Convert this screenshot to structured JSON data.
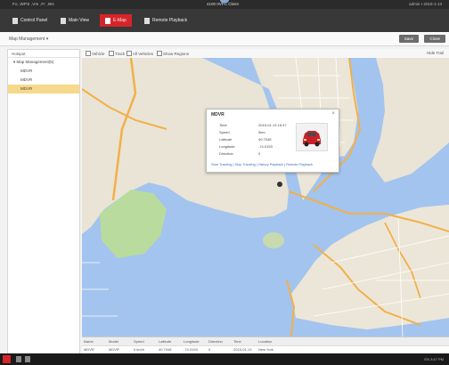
{
  "titlebar": {
    "menu": "Fo  ,WPS  ,Vm  ,Fr  ,Ws",
    "title": "4100 0VPC Client",
    "right": "admin   ▪  2015-1-13"
  },
  "toolbar": {
    "items": [
      {
        "label": "Control Panel",
        "icon": "control-panel-icon"
      },
      {
        "label": "Main View",
        "icon": "main-view-icon"
      },
      {
        "label": "E-Map",
        "icon": "map-icon",
        "active": true
      },
      {
        "label": "Remote Playback",
        "icon": "chart-icon"
      }
    ]
  },
  "subbar": {
    "breadcrumb": "Map Management ▾",
    "buttons": [
      "Save",
      "Close"
    ]
  },
  "leftpanel": {
    "header": "Hotspot",
    "items": [
      "▾ Map Management(5)",
      "MDVR",
      "MDVR",
      "MDVR"
    ]
  },
  "mapbar": {
    "options": [
      "Vehicle",
      "Track",
      "All Vehicles",
      "Show Regions"
    ],
    "right": "Hide Trail"
  },
  "popup": {
    "title": "MDVR",
    "rows": [
      {
        "k": "Time",
        "v": "2015-01-13 15:47"
      },
      {
        "k": "Speed",
        "v": "0km"
      },
      {
        "k": "Latitude",
        "v": "40.7048"
      },
      {
        "k": "Longitude",
        "v": "-74.0153"
      },
      {
        "k": "Direction",
        "v": "0"
      }
    ],
    "links": "Start Tracking  |  Stop Tracking  |  History Playback  |  Remote Playback"
  },
  "table": {
    "headers": [
      "Name",
      "Model",
      "Speed",
      "Latitude",
      "Longitude",
      "Direction",
      "Time",
      "Location"
    ],
    "row": [
      "MDVR",
      "MDVR",
      "0 km/h",
      "40.7048",
      "-74.0153",
      "0",
      "2015-01-13",
      "New York"
    ]
  },
  "taskbar": {
    "tray": "EN  3:47 PM"
  },
  "colors": {
    "accent": "#d6242b",
    "water": "#a3c4ee",
    "land": "#eae4d6",
    "park": "#b9dc9e",
    "highway": "#f2b04a"
  }
}
